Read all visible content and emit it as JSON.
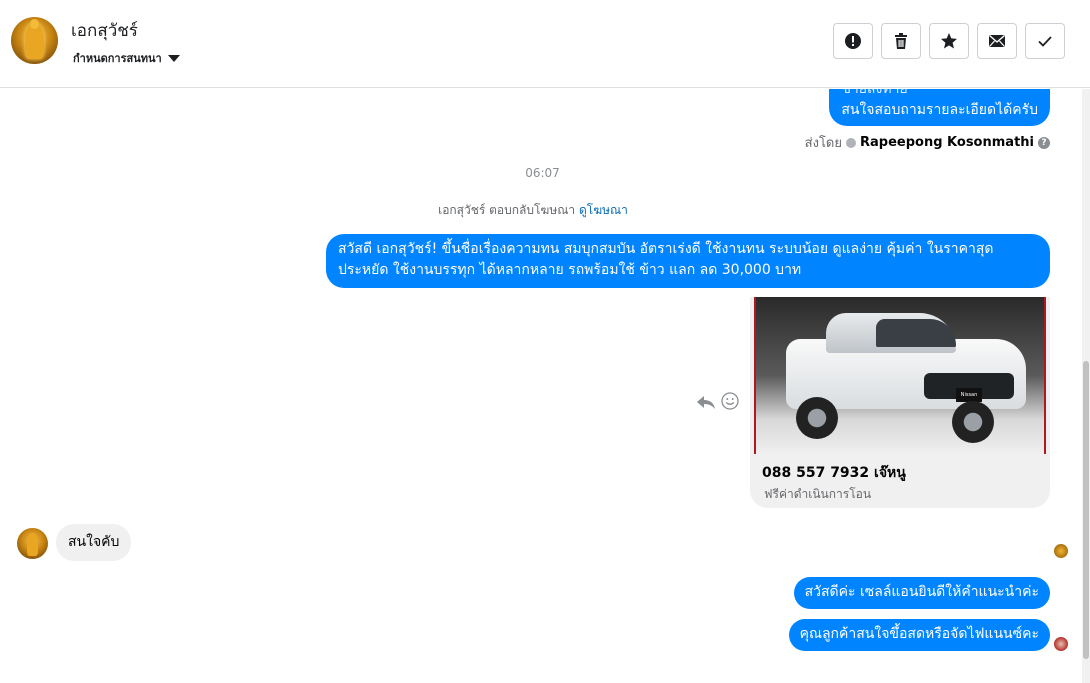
{
  "header": {
    "contact_name": "เอกสุวัชร์",
    "subtitle": "กำหนดการสนทนา"
  },
  "toolbar": [
    {
      "name": "report-button",
      "icon": "exclamation-icon"
    },
    {
      "name": "delete-button",
      "icon": "trash-icon"
    },
    {
      "name": "star-button",
      "icon": "star-icon"
    },
    {
      "name": "mark-unread-button",
      "icon": "envelope-icon"
    },
    {
      "name": "mark-done-button",
      "icon": "checkmark-icon"
    }
  ],
  "messages": {
    "top_partial_line1": "ขายส่งท่าย",
    "top_partial_line2": "สนใจสอบถามรายละเอียดได้ครับ",
    "sent_by_prefix": "ส่งโดย",
    "sent_by_name": "Rapeepong Kosonmathi",
    "timestamp": "06:07",
    "ad_reply_text": "เอกสุวัชร์ ตอบกลับโฆษณา",
    "ad_reply_link": "ดูโฆษณา",
    "ad_message": "สวัสดี เอกสุวัชร์! ขึ้นชื่อเรื่องความทน สมบุกสมบัน อัตราเร่งดี ใช้งานทน ระบบน้อย ดูแลง่าย คุ้มค่า ในราคาสุด ประหยัด ใช้งานบรรทุก ได้หลากหลาย รถพร้อมใช้ ข้าว แลก ลด 30,000 บาท",
    "ad_card_title": "088 557 7932 เจ๊หนู",
    "ad_card_sub": "ฟรีค่าดำเนินการโอน",
    "incoming_message": "สนใจคับ",
    "reply_1": "สวัสดีค่ะ เซลล์แอนยินดีให้คำแนะนำค่ะ",
    "reply_2": "คุณลูกค้าสนใจขึ้อสดหรือจัดไฟแนนซ์คะ"
  },
  "colors": {
    "outgoing_bubble": "#0084ff",
    "incoming_bubble": "#f0f0f0",
    "link": "#0a6bb5"
  }
}
